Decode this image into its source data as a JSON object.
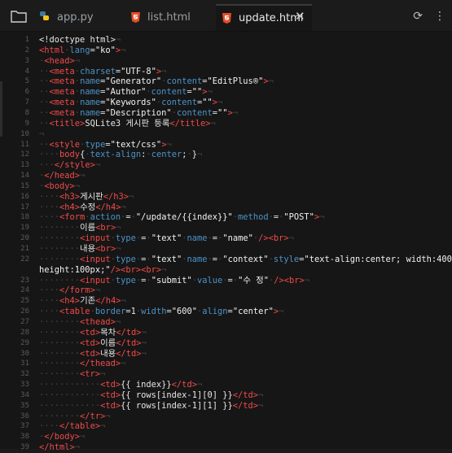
{
  "tabs": [
    {
      "label": "app.py",
      "icon": "python-icon"
    },
    {
      "label": "list.html",
      "icon": "html5-icon"
    },
    {
      "label": "update.html",
      "icon": "html5-icon",
      "active": true
    }
  ],
  "code_lines": [
    {
      "n": "1",
      "segs": [
        [
          "n",
          "<!doctype html>"
        ],
        [
          "w",
          "¬"
        ]
      ]
    },
    {
      "n": "2",
      "segs": [
        [
          "t",
          "<html"
        ],
        [
          "w",
          "·"
        ],
        [
          "a",
          "lang"
        ],
        [
          "n",
          "="
        ],
        [
          "s",
          "\"ko\""
        ],
        [
          "t",
          ">"
        ],
        [
          "w",
          "¬"
        ]
      ]
    },
    {
      "n": "3",
      "segs": [
        [
          "w",
          "·"
        ],
        [
          "t",
          "<head>"
        ],
        [
          "w",
          "¬"
        ]
      ]
    },
    {
      "n": "4",
      "segs": [
        [
          "w",
          "··"
        ],
        [
          "t",
          "<meta"
        ],
        [
          "w",
          "·"
        ],
        [
          "a",
          "charset"
        ],
        [
          "n",
          "="
        ],
        [
          "s",
          "\"UTF-8\""
        ],
        [
          "t",
          ">"
        ],
        [
          "w",
          "¬"
        ]
      ]
    },
    {
      "n": "5",
      "segs": [
        [
          "w",
          "··"
        ],
        [
          "t",
          "<meta"
        ],
        [
          "w",
          "·"
        ],
        [
          "a",
          "name"
        ],
        [
          "n",
          "="
        ],
        [
          "s",
          "\"Generator\""
        ],
        [
          "w",
          "·"
        ],
        [
          "a",
          "content"
        ],
        [
          "n",
          "="
        ],
        [
          "s",
          "\"EditPlus®\""
        ],
        [
          "t",
          ">"
        ],
        [
          "w",
          "¬"
        ]
      ]
    },
    {
      "n": "6",
      "segs": [
        [
          "w",
          "··"
        ],
        [
          "t",
          "<meta"
        ],
        [
          "w",
          "·"
        ],
        [
          "a",
          "name"
        ],
        [
          "n",
          "="
        ],
        [
          "s",
          "\"Author\""
        ],
        [
          "w",
          "·"
        ],
        [
          "a",
          "content"
        ],
        [
          "n",
          "="
        ],
        [
          "s",
          "\"\""
        ],
        [
          "t",
          ">"
        ],
        [
          "w",
          "¬"
        ]
      ]
    },
    {
      "n": "7",
      "segs": [
        [
          "w",
          "··"
        ],
        [
          "t",
          "<meta"
        ],
        [
          "w",
          "·"
        ],
        [
          "a",
          "name"
        ],
        [
          "n",
          "="
        ],
        [
          "s",
          "\"Keywords\""
        ],
        [
          "w",
          "·"
        ],
        [
          "a",
          "content"
        ],
        [
          "n",
          "="
        ],
        [
          "s",
          "\"\""
        ],
        [
          "t",
          ">"
        ],
        [
          "w",
          "¬"
        ]
      ]
    },
    {
      "n": "8",
      "segs": [
        [
          "w",
          "··"
        ],
        [
          "t",
          "<meta"
        ],
        [
          "w",
          "·"
        ],
        [
          "a",
          "name"
        ],
        [
          "n",
          "="
        ],
        [
          "s",
          "\"Description\""
        ],
        [
          "w",
          "·"
        ],
        [
          "a",
          "content"
        ],
        [
          "n",
          "="
        ],
        [
          "s",
          "\"\""
        ],
        [
          "t",
          ">"
        ],
        [
          "w",
          "¬"
        ]
      ]
    },
    {
      "n": "9",
      "segs": [
        [
          "w",
          "··"
        ],
        [
          "t",
          "<title>"
        ],
        [
          "n",
          "SQLite3 게시판 등록"
        ],
        [
          "t",
          "</title>"
        ],
        [
          "w",
          "¬"
        ]
      ]
    },
    {
      "n": "10",
      "segs": [
        [
          "w",
          "¬"
        ]
      ]
    },
    {
      "n": "11",
      "segs": [
        [
          "w",
          "··"
        ],
        [
          "t",
          "<style"
        ],
        [
          "w",
          "·"
        ],
        [
          "a",
          "type"
        ],
        [
          "n",
          "="
        ],
        [
          "s",
          "\"text/css\""
        ],
        [
          "t",
          ">"
        ],
        [
          "w",
          "¬"
        ]
      ]
    },
    {
      "n": "12",
      "segs": [
        [
          "w",
          "····"
        ],
        [
          "t",
          "body"
        ],
        [
          "n",
          "{"
        ],
        [
          "w",
          "·"
        ],
        [
          "a",
          "text-align"
        ],
        [
          "n",
          ":"
        ],
        [
          "w",
          "·"
        ],
        [
          "a",
          "center"
        ],
        [
          "n",
          ";"
        ],
        [
          "w",
          "·"
        ],
        [
          "n",
          "}"
        ],
        [
          "w",
          "¬"
        ]
      ]
    },
    {
      "n": "13",
      "segs": [
        [
          "w",
          "···"
        ],
        [
          "t",
          "</style>"
        ],
        [
          "w",
          "¬"
        ]
      ]
    },
    {
      "n": "14",
      "segs": [
        [
          "w",
          "·"
        ],
        [
          "t",
          "</head>"
        ],
        [
          "w",
          "¬"
        ]
      ]
    },
    {
      "n": "15",
      "segs": [
        [
          "w",
          "·"
        ],
        [
          "t",
          "<body>"
        ],
        [
          "w",
          "¬"
        ]
      ]
    },
    {
      "n": "16",
      "segs": [
        [
          "w",
          "····"
        ],
        [
          "t",
          "<h3>"
        ],
        [
          "n",
          "게시판"
        ],
        [
          "t",
          "</h3>"
        ],
        [
          "w",
          "¬"
        ]
      ]
    },
    {
      "n": "17",
      "segs": [
        [
          "w",
          "····"
        ],
        [
          "t",
          "<h4>"
        ],
        [
          "n",
          "수정"
        ],
        [
          "t",
          "</h4>"
        ],
        [
          "w",
          "¬"
        ]
      ]
    },
    {
      "n": "18",
      "segs": [
        [
          "w",
          "····"
        ],
        [
          "t",
          "<form"
        ],
        [
          "w",
          "·"
        ],
        [
          "a",
          "action"
        ],
        [
          "w",
          "·"
        ],
        [
          "n",
          "="
        ],
        [
          "w",
          "·"
        ],
        [
          "s",
          "\"/update/{{index}}\""
        ],
        [
          "w",
          "·"
        ],
        [
          "a",
          "method"
        ],
        [
          "w",
          "·"
        ],
        [
          "n",
          "="
        ],
        [
          "w",
          "·"
        ],
        [
          "s",
          "\"POST\""
        ],
        [
          "t",
          ">"
        ],
        [
          "w",
          "¬"
        ]
      ]
    },
    {
      "n": "19",
      "segs": [
        [
          "w",
          "········"
        ],
        [
          "n",
          "이름"
        ],
        [
          "t",
          "<br>"
        ],
        [
          "w",
          "¬"
        ]
      ]
    },
    {
      "n": "20",
      "segs": [
        [
          "w",
          "········"
        ],
        [
          "t",
          "<input"
        ],
        [
          "w",
          "·"
        ],
        [
          "a",
          "type"
        ],
        [
          "w",
          "·"
        ],
        [
          "n",
          "="
        ],
        [
          "w",
          "·"
        ],
        [
          "s",
          "\"text\""
        ],
        [
          "w",
          "·"
        ],
        [
          "a",
          "name"
        ],
        [
          "w",
          "·"
        ],
        [
          "n",
          "="
        ],
        [
          "w",
          "·"
        ],
        [
          "s",
          "\"name\""
        ],
        [
          "w",
          "·"
        ],
        [
          "t",
          "/><br>"
        ],
        [
          "w",
          "¬"
        ]
      ]
    },
    {
      "n": "21",
      "segs": [
        [
          "w",
          "········"
        ],
        [
          "n",
          "내용"
        ],
        [
          "t",
          "<br>"
        ],
        [
          "w",
          "¬"
        ]
      ]
    },
    {
      "n": "22",
      "segs": [
        [
          "w",
          "········"
        ],
        [
          "t",
          "<input"
        ],
        [
          "w",
          "·"
        ],
        [
          "a",
          "type"
        ],
        [
          "w",
          "·"
        ],
        [
          "n",
          "="
        ],
        [
          "w",
          "·"
        ],
        [
          "s",
          "\"text\""
        ],
        [
          "w",
          "·"
        ],
        [
          "a",
          "name"
        ],
        [
          "w",
          "·"
        ],
        [
          "n",
          "="
        ],
        [
          "w",
          "·"
        ],
        [
          "s",
          "\"context\""
        ],
        [
          "w",
          "·"
        ],
        [
          "a",
          "style"
        ],
        [
          "n",
          "="
        ],
        [
          "s",
          "\"text-align:center; width:400px;"
        ]
      ]
    },
    {
      "n": "",
      "segs": [
        [
          "s",
          "height:100px;\""
        ],
        [
          "t",
          "/><br><br>"
        ],
        [
          "w",
          "¬"
        ]
      ]
    },
    {
      "n": "23",
      "segs": [
        [
          "w",
          "········"
        ],
        [
          "t",
          "<input"
        ],
        [
          "w",
          "·"
        ],
        [
          "a",
          "type"
        ],
        [
          "w",
          "·"
        ],
        [
          "n",
          "="
        ],
        [
          "w",
          "·"
        ],
        [
          "s",
          "\"submit\""
        ],
        [
          "w",
          "·"
        ],
        [
          "a",
          "value"
        ],
        [
          "w",
          "·"
        ],
        [
          "n",
          "="
        ],
        [
          "w",
          "·"
        ],
        [
          "s",
          "\"수 정\""
        ],
        [
          "w",
          "·"
        ],
        [
          "t",
          "/><br>"
        ],
        [
          "w",
          "¬"
        ]
      ]
    },
    {
      "n": "24",
      "segs": [
        [
          "w",
          "····"
        ],
        [
          "t",
          "</form>"
        ],
        [
          "w",
          "¬"
        ]
      ]
    },
    {
      "n": "25",
      "segs": [
        [
          "w",
          "····"
        ],
        [
          "t",
          "<h4>"
        ],
        [
          "n",
          "기존"
        ],
        [
          "t",
          "</h4>"
        ],
        [
          "w",
          "¬"
        ]
      ]
    },
    {
      "n": "26",
      "segs": [
        [
          "w",
          "····"
        ],
        [
          "t",
          "<table"
        ],
        [
          "w",
          "·"
        ],
        [
          "a",
          "border"
        ],
        [
          "n",
          "=1"
        ],
        [
          "w",
          "·"
        ],
        [
          "a",
          "width"
        ],
        [
          "n",
          "="
        ],
        [
          "s",
          "\"600\""
        ],
        [
          "w",
          "·"
        ],
        [
          "a",
          "align"
        ],
        [
          "n",
          "="
        ],
        [
          "s",
          "\"center\""
        ],
        [
          "t",
          ">"
        ],
        [
          "w",
          "¬"
        ]
      ]
    },
    {
      "n": "27",
      "segs": [
        [
          "w",
          "········"
        ],
        [
          "t",
          "<thead>"
        ],
        [
          "w",
          "¬"
        ]
      ]
    },
    {
      "n": "28",
      "segs": [
        [
          "w",
          "········"
        ],
        [
          "t",
          "<td>"
        ],
        [
          "n",
          "목차"
        ],
        [
          "t",
          "</td>"
        ],
        [
          "w",
          "¬"
        ]
      ]
    },
    {
      "n": "29",
      "segs": [
        [
          "w",
          "········"
        ],
        [
          "t",
          "<td>"
        ],
        [
          "n",
          "이름"
        ],
        [
          "t",
          "</td>"
        ],
        [
          "w",
          "¬"
        ]
      ]
    },
    {
      "n": "30",
      "segs": [
        [
          "w",
          "········"
        ],
        [
          "t",
          "<td>"
        ],
        [
          "n",
          "내용"
        ],
        [
          "t",
          "</td>"
        ],
        [
          "w",
          "¬"
        ]
      ]
    },
    {
      "n": "31",
      "segs": [
        [
          "w",
          "········"
        ],
        [
          "t",
          "</thead>"
        ],
        [
          "w",
          "¬"
        ]
      ]
    },
    {
      "n": "32",
      "segs": [
        [
          "w",
          "········"
        ],
        [
          "t",
          "<tr>"
        ],
        [
          "w",
          "¬"
        ]
      ]
    },
    {
      "n": "33",
      "segs": [
        [
          "w",
          "············"
        ],
        [
          "t",
          "<td>"
        ],
        [
          "n",
          "{{ index}}"
        ],
        [
          "t",
          "</td>"
        ],
        [
          "w",
          "¬"
        ]
      ]
    },
    {
      "n": "34",
      "segs": [
        [
          "w",
          "············"
        ],
        [
          "t",
          "<td>"
        ],
        [
          "n",
          "{{ rows[index-1][0] }}"
        ],
        [
          "t",
          "</td>"
        ],
        [
          "w",
          "¬"
        ]
      ]
    },
    {
      "n": "35",
      "segs": [
        [
          "w",
          "············"
        ],
        [
          "t",
          "<td>"
        ],
        [
          "n",
          "{{ rows[index-1][1] }}"
        ],
        [
          "t",
          "</td>"
        ],
        [
          "w",
          "¬"
        ]
      ]
    },
    {
      "n": "36",
      "segs": [
        [
          "w",
          "········"
        ],
        [
          "t",
          "</tr>"
        ],
        [
          "w",
          "¬"
        ]
      ]
    },
    {
      "n": "37",
      "segs": [
        [
          "w",
          "····"
        ],
        [
          "t",
          "</table>"
        ],
        [
          "w",
          "¬"
        ]
      ]
    },
    {
      "n": "38",
      "segs": [
        [
          "w",
          "·"
        ],
        [
          "t",
          "</body>"
        ],
        [
          "w",
          "¬"
        ]
      ]
    },
    {
      "n": "39",
      "segs": [
        [
          "t",
          "</html>"
        ],
        [
          "w",
          "¬"
        ]
      ]
    }
  ]
}
